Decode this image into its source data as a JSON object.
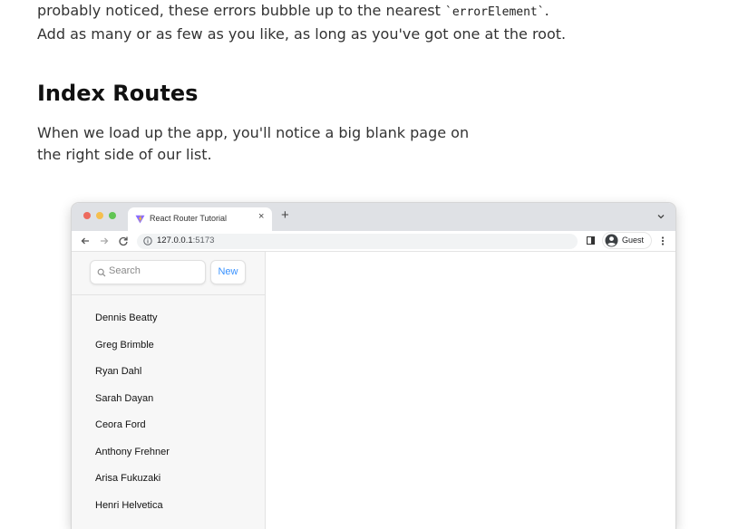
{
  "article": {
    "para1_line1_pre": "probably noticed, these errors bubble up to the nearest ",
    "para1_code": "`errorElement`",
    "para1_line1_post": ".",
    "para1_line2": "Add as many or as few as you like, as long as you've got one at the root.",
    "heading": "Index Routes",
    "para2": "When we load up the app, you'll notice a big blank page on the right side of our list."
  },
  "browser": {
    "tab_title": "React Router Tutorial",
    "tab_close": "×",
    "new_tab": "+",
    "url_host": "127.0.0.1",
    "url_port": ":5173",
    "profile_label": "Guest"
  },
  "app": {
    "search_placeholder": "Search",
    "new_button": "New",
    "contacts": [
      "Dennis Beatty",
      "Greg Brimble",
      "Ryan Dahl",
      "Sarah Dayan",
      "Ceora Ford",
      "Anthony Frehner",
      "Arisa Fukuzaki",
      "Henri Helvetica"
    ]
  },
  "icons": {
    "traffic_lights": [
      "red-dot",
      "yellow-dot",
      "green-dot"
    ],
    "vite_logo": "vite-logo-icon",
    "nav": [
      "back-arrow-icon",
      "forward-arrow-icon",
      "reload-icon"
    ],
    "site_info": "info-icon",
    "side_panel": "side-panel-icon",
    "avatar": "avatar-icon",
    "menu": "kebab-menu-icon",
    "tabs_dropdown": "chevron-down-icon",
    "search": "search-icon"
  },
  "colors": {
    "accent": "#3992ff",
    "titlebar": "#dfe1e5",
    "sidebar_bg": "#f7f7f7"
  }
}
